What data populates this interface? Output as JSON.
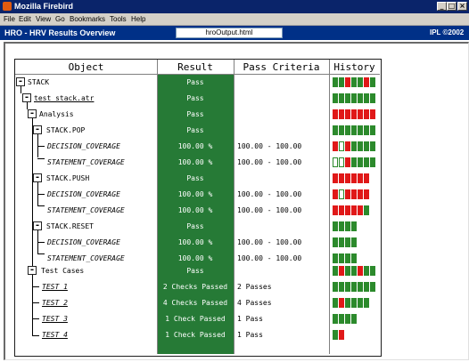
{
  "window": {
    "title": "Mozilla Firebird",
    "buttons": [
      "_",
      "□",
      "×"
    ]
  },
  "menubar": {
    "items": [
      "File",
      "Edit",
      "View",
      "Go",
      "Bookmarks",
      "Tools",
      "Help"
    ]
  },
  "header": {
    "title": "HRO - HRV Results Overview",
    "url": "hroOutput.html",
    "copyright": "IPL ©2002"
  },
  "table": {
    "headers": [
      "Object",
      "Result",
      "Pass Criteria",
      "History"
    ],
    "colors": {
      "pass_band": "#267a36",
      "history_green": "#2c8a2c",
      "history_red": "#e01818",
      "history_white": "#ffffff"
    },
    "rows": [
      {
        "label": "STACK",
        "result": "Pass",
        "criteria": "",
        "history": "GGRGGRG"
      },
      {
        "label": "test_stack.atr",
        "result": "Pass",
        "criteria": "",
        "history": "GGGGGGG"
      },
      {
        "label": "Analysis",
        "result": "Pass",
        "criteria": "",
        "history": "RRRRRRR"
      },
      {
        "label": "STACK.POP",
        "result": "Pass",
        "criteria": "",
        "history": "GGGGGGG"
      },
      {
        "label": "DECISION_COVERAGE",
        "result": "100.00 %",
        "criteria": "100.00 - 100.00",
        "history": "RWRGGGG"
      },
      {
        "label": "STATEMENT_COVERAGE",
        "result": "100.00 %",
        "criteria": "100.00 - 100.00",
        "history": "WWRGGGG"
      },
      {
        "label": "STACK.PUSH",
        "result": "Pass",
        "criteria": "",
        "history": "RRRRRR"
      },
      {
        "label": "DECISION_COVERAGE",
        "result": "100.00 %",
        "criteria": "100.00 - 100.00",
        "history": "RWRRRR"
      },
      {
        "label": "STATEMENT_COVERAGE",
        "result": "100.00 %",
        "criteria": "100.00 - 100.00",
        "history": "RRRRRG"
      },
      {
        "label": "STACK.RESET",
        "result": "Pass",
        "criteria": "",
        "history": "GGGG"
      },
      {
        "label": "DECISION_COVERAGE",
        "result": "100.00 %",
        "criteria": "100.00 - 100.00",
        "history": "GGGG"
      },
      {
        "label": "STATEMENT_COVERAGE",
        "result": "100.00 %",
        "criteria": "100.00 - 100.00",
        "history": "GGGG"
      },
      {
        "label": "Test Cases",
        "result": "Pass",
        "criteria": "",
        "history": "GRGGRGG"
      },
      {
        "label": "TEST_1",
        "result": "2 Checks Passed",
        "criteria": "2 Passes",
        "history": "GGGGGGG"
      },
      {
        "label": "TEST_2",
        "result": "4 Checks Passed",
        "criteria": "4 Passes",
        "history": "GRGGGG"
      },
      {
        "label": "TEST_3",
        "result": "1 Check Passed",
        "criteria": "1 Pass",
        "history": "GGGG"
      },
      {
        "label": "TEST_4",
        "result": "1 Check Passed",
        "criteria": "1 Pass",
        "history": "GR"
      }
    ]
  }
}
